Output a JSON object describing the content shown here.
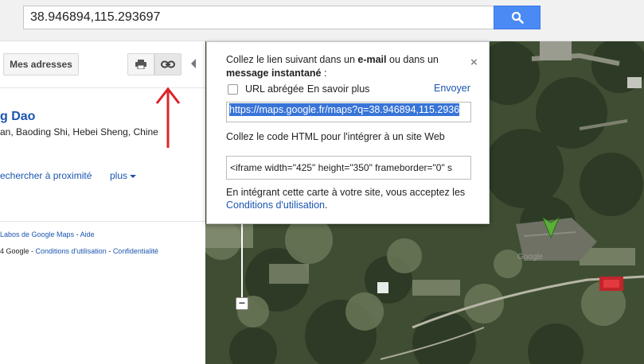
{
  "search": {
    "value": "38.946894,115.293697"
  },
  "left_panel": {
    "mes_adresses_label": "Mes adresses",
    "place_title": "g Dao",
    "place_address": "an, Baoding Shi, Hebei Sheng, Chine",
    "nearby_label": "echercher à proximité",
    "plus_label": "plus",
    "footer_line1": {
      "text": "Labos de Google Maps",
      "sep": " - ",
      "aide": "Aide"
    },
    "footer_line2": {
      "prefix": "4 Google",
      "sep1": " - ",
      "conditions": "Conditions d'utilisation",
      "sep2": " - ",
      "confidentialite": "Confidentialité"
    }
  },
  "popup": {
    "intro_part1": "Collez le lien suivant dans un ",
    "intro_bold1": "e-mail",
    "intro_part2": " ou dans un ",
    "intro_bold2": "message instantané",
    "intro_part3": " :",
    "close_symbol": "×",
    "short_url_label": "URL abrégée",
    "learn_more": "En savoir plus",
    "send_label": "Envoyer",
    "url_value": "https://maps.google.fr/maps?q=38.946894,115.2936",
    "html_label": "Collez le code HTML pour l'intégrer à un site Web",
    "html_value": "<iframe width=\"425\" height=\"350\" frameborder=\"0\" s",
    "terms_text": "En intégrant cette carte à votre site, vous acceptez les ",
    "terms_link": "Conditions d'utilisation",
    "terms_end": "."
  },
  "map": {
    "zoom_out_symbol": "−",
    "faint_label": "Google"
  },
  "colors": {
    "accent_blue": "#4a8af4",
    "link_blue": "#1a55b0",
    "red_arrow": "#d9262b",
    "marker_green": "#5ab036"
  },
  "icons": [
    "search-icon",
    "print-icon",
    "link-icon",
    "collapse-arrow-icon",
    "close-icon",
    "red-arrow-annotation",
    "map-marker-icon"
  ]
}
